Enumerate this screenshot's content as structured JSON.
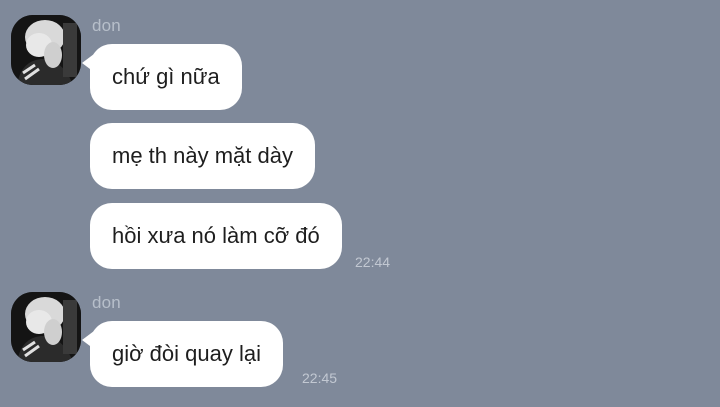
{
  "chat": {
    "groups": [
      {
        "sender": "don",
        "avatar_icon": "user-avatar-photo",
        "messages": [
          "chứ gì nữa",
          "mẹ th này mặt dày",
          "hồi xưa nó làm cỡ đó"
        ],
        "time": "22:44"
      },
      {
        "sender": "don",
        "avatar_icon": "user-avatar-photo",
        "messages": [
          "giờ đòi quay lại"
        ],
        "time": "22:45"
      }
    ]
  },
  "colors": {
    "background": "#7f899a",
    "bubble": "#ffffff",
    "sender_text": "#b7bfca",
    "time_text": "#c2c8d2"
  }
}
